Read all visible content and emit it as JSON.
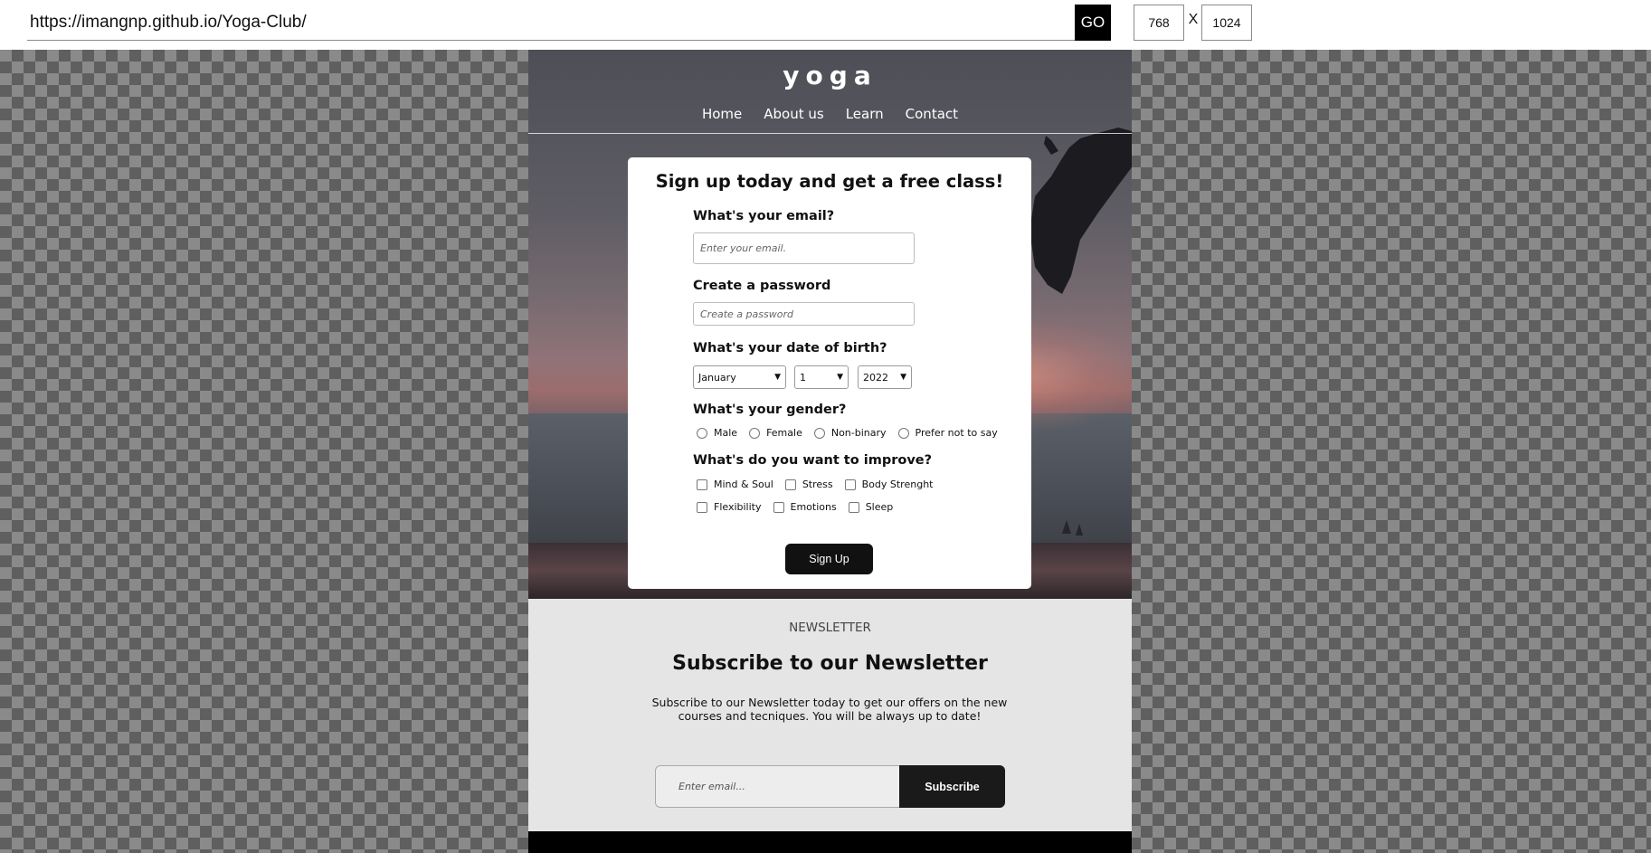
{
  "toolbar": {
    "url": "https://imangnp.github.io/Yoga-Club/",
    "go_label": "GO",
    "width_value": "768",
    "height_value": "1024",
    "separator": "X"
  },
  "site": {
    "logo": "yoga",
    "nav": [
      "Home",
      "About us",
      "Learn",
      "Contact"
    ]
  },
  "signup": {
    "title": "Sign up today and get a free class!",
    "email_label": "What's your email?",
    "email_placeholder": "Enter your email.",
    "password_label": "Create a password",
    "password_placeholder": "Create a password",
    "dob_label": "What's your date of birth?",
    "dob_month": "January",
    "dob_day": "1",
    "dob_year": "2022",
    "gender_label": "What's your gender?",
    "gender_options": [
      "Male",
      "Female",
      "Non-binary",
      "Prefer not to say"
    ],
    "improve_label": "What's do you want to improve?",
    "improve_options_row1": [
      "Mind & Soul",
      "Stress",
      "Body Strenght"
    ],
    "improve_options_row2": [
      "Flexibility",
      "Emotions",
      "Sleep"
    ],
    "submit_label": "Sign Up"
  },
  "newsletter": {
    "eyebrow": "NEWSLETTER",
    "title": "Subscribe to our Newsletter",
    "body": "Subscribe to our Newsletter today to get our offers on the new courses and tecniques. You will be always up to date!",
    "email_placeholder": "Enter email...",
    "subscribe_label": "Subscribe"
  },
  "colors": {
    "accent_dark": "#111111",
    "newsletter_bg": "#e5e5e5",
    "checker_light": "#8a8a8a",
    "checker_dark": "#5f5f5f"
  }
}
